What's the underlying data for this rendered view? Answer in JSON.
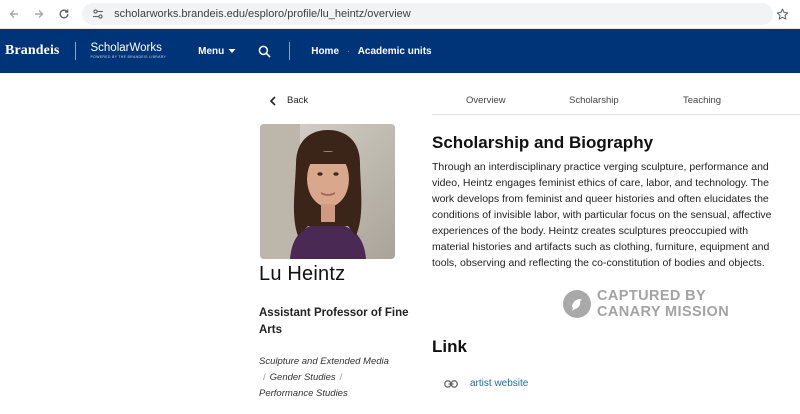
{
  "browser": {
    "url": "scholarworks.brandeis.edu/esploro/profile/lu_heintz/overview"
  },
  "header": {
    "brand": "Brandeis",
    "product": "ScholarWorks",
    "product_tagline": "POWERED BY THE BRANDEIS LIBRARY",
    "menu_label": "Menu",
    "nav": [
      "Home",
      "Academic units"
    ]
  },
  "profile": {
    "back_label": "Back",
    "name": "Lu Heintz",
    "title": "Assistant Professor of Fine Arts",
    "areas": [
      "Sculpture and Extended Media",
      "Gender Studies",
      "Performance Studies"
    ]
  },
  "tabs": [
    "Overview",
    "Scholarship",
    "Teaching"
  ],
  "main": {
    "heading": "Scholarship and Biography",
    "bio": "Through an interdisciplinary practice verging sculpture, performance and video, Heintz engages feminist ethics of care, labor, and technology. The work develops from feminist and queer histories and often elucidates the conditions of invisible labor, with particular focus on the sensual, affective experiences of the body. Heintz creates sculptures preoccupied with material histories and artifacts such as clothing, furniture, equipment and tools, observing and reflecting the co-constitution of bodies and objects.",
    "link_heading": "Link",
    "link_label": "artist website"
  },
  "watermark": {
    "line1": "CAPTURED BY",
    "line2": "CANARY MISSION"
  },
  "colors": {
    "header_bg": "#003478",
    "link": "#1f6aa5"
  }
}
